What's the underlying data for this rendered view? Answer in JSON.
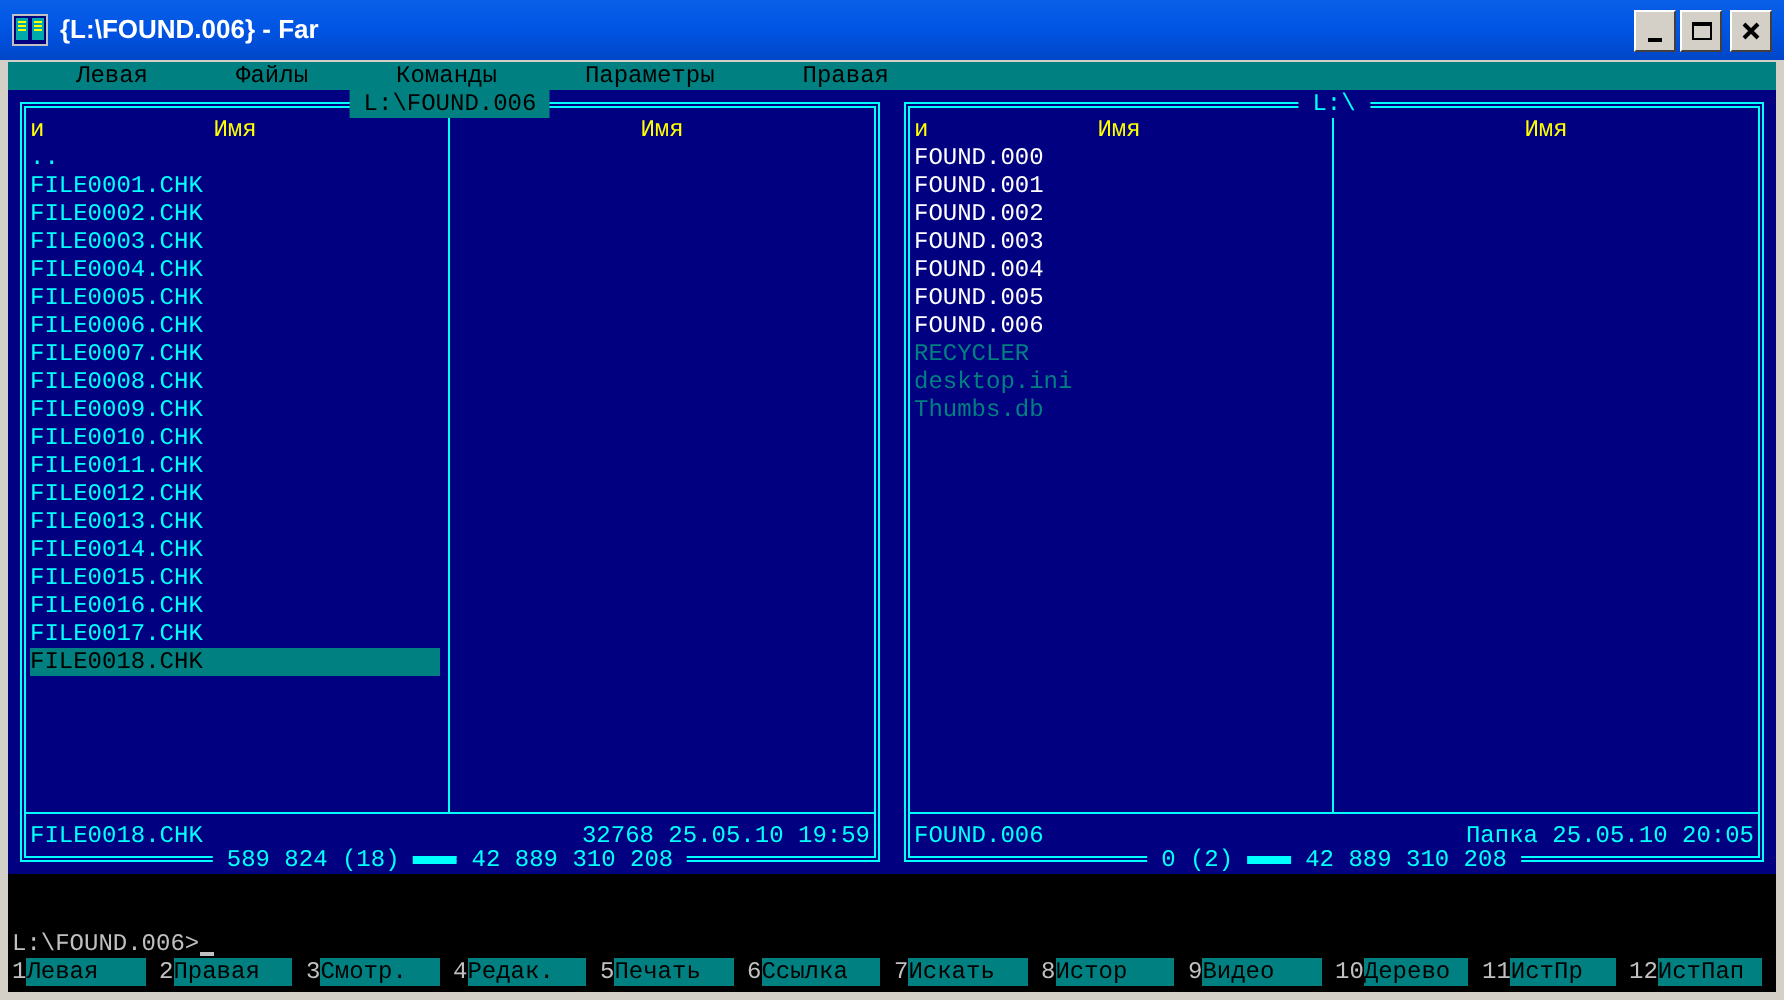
{
  "window": {
    "title": "{L:\\FOUND.006} - Far"
  },
  "menu": [
    "Левая",
    "Файлы",
    "Команды",
    "Параметры",
    "Правая"
  ],
  "panels": [
    {
      "path": "L:\\FOUND.006",
      "active": true,
      "sort_mark": "и",
      "columns": [
        "Имя",
        "Имя"
      ],
      "files": [
        {
          "name": "..",
          "kind": "file",
          "selected": false
        },
        {
          "name": "FILE0001.CHK",
          "kind": "file",
          "selected": false
        },
        {
          "name": "FILE0002.CHK",
          "kind": "file",
          "selected": false
        },
        {
          "name": "FILE0003.CHK",
          "kind": "file",
          "selected": false
        },
        {
          "name": "FILE0004.CHK",
          "kind": "file",
          "selected": false
        },
        {
          "name": "FILE0005.CHK",
          "kind": "file",
          "selected": false
        },
        {
          "name": "FILE0006.CHK",
          "kind": "file",
          "selected": false
        },
        {
          "name": "FILE0007.CHK",
          "kind": "file",
          "selected": false
        },
        {
          "name": "FILE0008.CHK",
          "kind": "file",
          "selected": false
        },
        {
          "name": "FILE0009.CHK",
          "kind": "file",
          "selected": false
        },
        {
          "name": "FILE0010.CHK",
          "kind": "file",
          "selected": false
        },
        {
          "name": "FILE0011.CHK",
          "kind": "file",
          "selected": false
        },
        {
          "name": "FILE0012.CHK",
          "kind": "file",
          "selected": false
        },
        {
          "name": "FILE0013.CHK",
          "kind": "file",
          "selected": false
        },
        {
          "name": "FILE0014.CHK",
          "kind": "file",
          "selected": false
        },
        {
          "name": "FILE0015.CHK",
          "kind": "file",
          "selected": false
        },
        {
          "name": "FILE0016.CHK",
          "kind": "file",
          "selected": false
        },
        {
          "name": "FILE0017.CHK",
          "kind": "file",
          "selected": false
        },
        {
          "name": "FILE0018.CHK",
          "kind": "file",
          "selected": true
        }
      ],
      "info_name": "FILE0018.CHK",
      "info_details": "32768 25.05.10 19:59",
      "totals": [
        "589 824 (18)",
        "42 889 310 208"
      ]
    },
    {
      "path": "L:\\",
      "active": false,
      "sort_mark": "и",
      "columns": [
        "Имя",
        "Имя"
      ],
      "files": [
        {
          "name": "FOUND.000",
          "kind": "folder",
          "selected": false
        },
        {
          "name": "FOUND.001",
          "kind": "folder",
          "selected": false
        },
        {
          "name": "FOUND.002",
          "kind": "folder",
          "selected": false
        },
        {
          "name": "FOUND.003",
          "kind": "folder",
          "selected": false
        },
        {
          "name": "FOUND.004",
          "kind": "folder",
          "selected": false
        },
        {
          "name": "FOUND.005",
          "kind": "folder",
          "selected": false
        },
        {
          "name": "FOUND.006",
          "kind": "folder",
          "selected": false
        },
        {
          "name": "RECYCLER",
          "kind": "hidden",
          "selected": false
        },
        {
          "name": "desktop.ini",
          "kind": "hidden",
          "selected": false
        },
        {
          "name": "Thumbs.db",
          "kind": "hidden",
          "selected": false
        }
      ],
      "info_name": "FOUND.006",
      "info_details": "Папка 25.05.10 20:05",
      "totals": [
        "0 (2)",
        "42 889 310 208"
      ]
    }
  ],
  "command_line": {
    "prompt": "L:\\FOUND.006>"
  },
  "keybar": [
    {
      "num": "1",
      "label": "Левая"
    },
    {
      "num": "2",
      "label": "Правая"
    },
    {
      "num": "3",
      "label": "Смотр."
    },
    {
      "num": "4",
      "label": "Редак."
    },
    {
      "num": "5",
      "label": "Печать"
    },
    {
      "num": "6",
      "label": "Ссылка"
    },
    {
      "num": "7",
      "label": "Искать"
    },
    {
      "num": "8",
      "label": "Истор"
    },
    {
      "num": "9",
      "label": "Видео"
    },
    {
      "num": "10",
      "label": "Дерево"
    },
    {
      "num": "11",
      "label": "ИстПр"
    },
    {
      "num": "12",
      "label": "ИстПап"
    }
  ]
}
